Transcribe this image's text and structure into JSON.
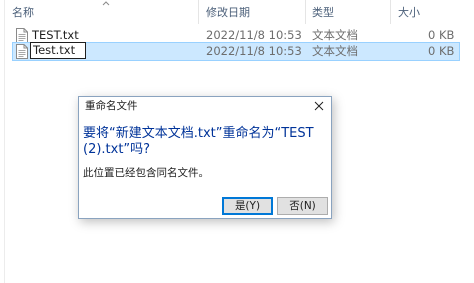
{
  "columns": {
    "name": "名称",
    "modified": "修改日期",
    "type": "类型",
    "size": "大小"
  },
  "files": [
    {
      "name": "TEST.txt",
      "modified": "2022/11/8 10:53",
      "type": "文本文档",
      "size": "0 KB"
    },
    {
      "name": "Test.txt",
      "modified": "2022/11/8 10:53",
      "type": "文本文档",
      "size": "0 KB",
      "selected": true,
      "renaming": true
    }
  ],
  "dialog": {
    "title": "重命名文件",
    "question": "要将“新建文本文档.txt”重命名为“TEST (2).txt”吗?",
    "info": "此位置已经包含同名文件。",
    "yes_label": "是(Y)",
    "no_label": "否(N)"
  },
  "colors": {
    "selection_bg": "#cce8ff",
    "selection_border": "#99d1ff",
    "question_text": "#003399",
    "default_button_border": "#0078d7"
  }
}
